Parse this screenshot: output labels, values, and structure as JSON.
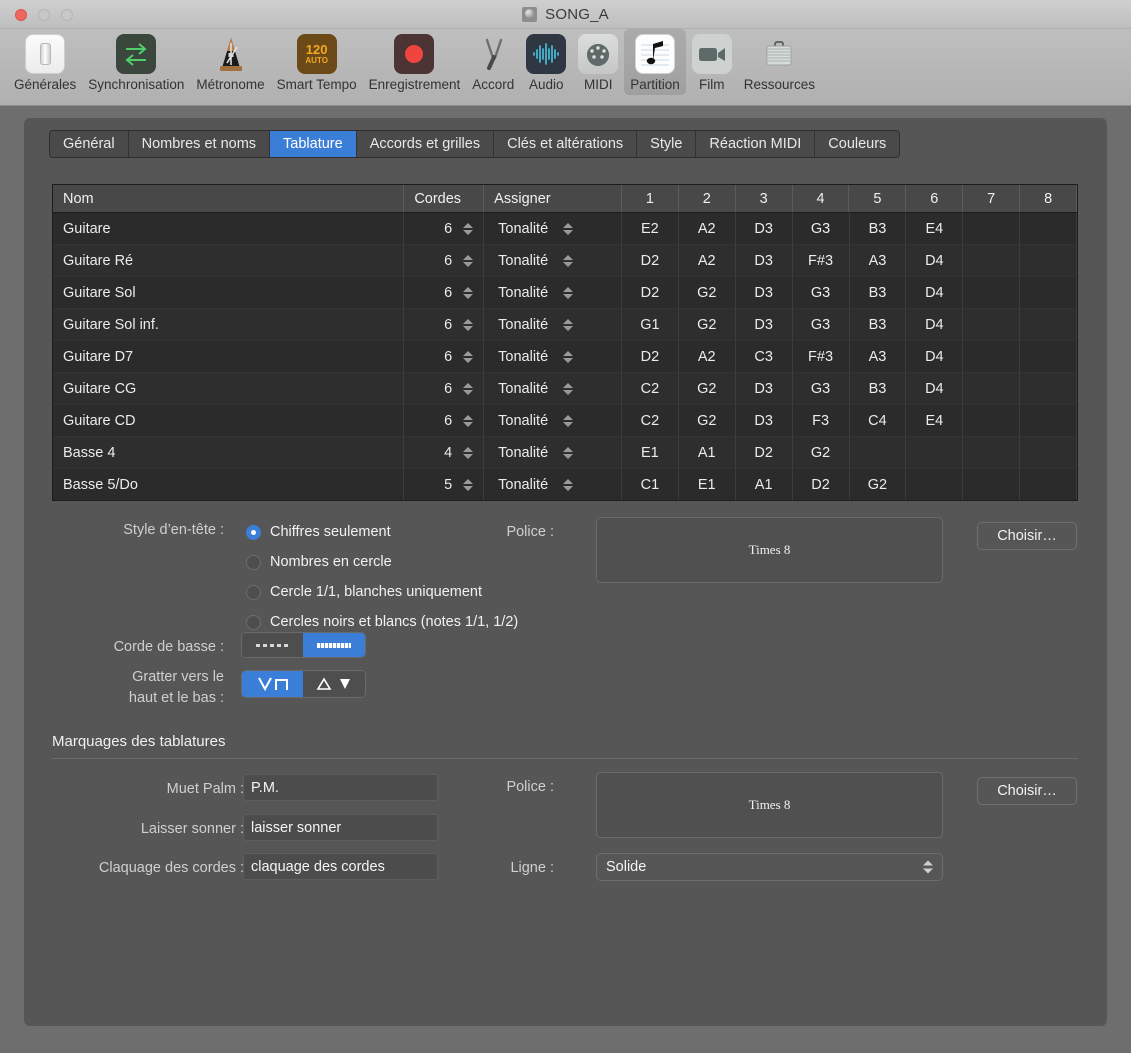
{
  "window": {
    "title": "SONG_A",
    "doc_icon": "disc-icon",
    "traffic_lights": [
      "close-button",
      "minimize-button",
      "zoom-button"
    ]
  },
  "toolbar": {
    "items": [
      {
        "label": "Générales",
        "icon": "switch-icon",
        "selected": false
      },
      {
        "label": "Synchronisation",
        "icon": "sync-arrows-icon",
        "selected": false
      },
      {
        "label": "Métronome",
        "icon": "metronome-icon",
        "selected": false
      },
      {
        "label": "Smart Tempo",
        "icon": "tempo-icon",
        "selected": false,
        "badge_top": "120",
        "badge_bottom": "AUTO"
      },
      {
        "label": "Enregistrement",
        "icon": "record-dot-icon",
        "selected": false
      },
      {
        "label": "Accord",
        "icon": "tuning-fork-icon",
        "selected": false
      },
      {
        "label": "Audio",
        "icon": "waveform-icon",
        "selected": false
      },
      {
        "label": "MIDI",
        "icon": "midi-plug-icon",
        "selected": false
      },
      {
        "label": "Partition",
        "icon": "music-note-icon",
        "selected": true
      },
      {
        "label": "Film",
        "icon": "video-camera-icon",
        "selected": false
      },
      {
        "label": "Ressources",
        "icon": "briefcase-icon",
        "selected": false
      }
    ]
  },
  "tabs": [
    {
      "label": "Général",
      "active": false
    },
    {
      "label": "Nombres et noms",
      "active": false
    },
    {
      "label": "Tablature",
      "active": true
    },
    {
      "label": "Accords et grilles",
      "active": false
    },
    {
      "label": "Clés et altérations",
      "active": false
    },
    {
      "label": "Style",
      "active": false
    },
    {
      "label": "Réaction MIDI",
      "active": false
    },
    {
      "label": "Couleurs",
      "active": false
    }
  ],
  "table": {
    "columns": [
      "Nom",
      "Cordes",
      "Assigner",
      "1",
      "2",
      "3",
      "4",
      "5",
      "6",
      "7",
      "8"
    ],
    "rows": [
      {
        "nom": "Guitare",
        "cordes": "6",
        "assigner": "Tonalité",
        "notes": [
          "E2",
          "A2",
          "D3",
          "G3",
          "B3",
          "E4",
          "",
          ""
        ]
      },
      {
        "nom": "Guitare Ré",
        "cordes": "6",
        "assigner": "Tonalité",
        "notes": [
          "D2",
          "A2",
          "D3",
          "F#3",
          "A3",
          "D4",
          "",
          ""
        ]
      },
      {
        "nom": "Guitare Sol",
        "cordes": "6",
        "assigner": "Tonalité",
        "notes": [
          "D2",
          "G2",
          "D3",
          "G3",
          "B3",
          "D4",
          "",
          ""
        ]
      },
      {
        "nom": "Guitare Sol inf.",
        "cordes": "6",
        "assigner": "Tonalité",
        "notes": [
          "G1",
          "G2",
          "D3",
          "G3",
          "B3",
          "D4",
          "",
          ""
        ]
      },
      {
        "nom": "Guitare D7",
        "cordes": "6",
        "assigner": "Tonalité",
        "notes": [
          "D2",
          "A2",
          "C3",
          "F#3",
          "A3",
          "D4",
          "",
          ""
        ]
      },
      {
        "nom": "Guitare CG",
        "cordes": "6",
        "assigner": "Tonalité",
        "notes": [
          "C2",
          "G2",
          "D3",
          "G3",
          "B3",
          "D4",
          "",
          ""
        ]
      },
      {
        "nom": "Guitare CD",
        "cordes": "6",
        "assigner": "Tonalité",
        "notes": [
          "C2",
          "G2",
          "D3",
          "F3",
          "C4",
          "E4",
          "",
          ""
        ]
      },
      {
        "nom": "Basse 4",
        "cordes": "4",
        "assigner": "Tonalité",
        "notes": [
          "E1",
          "A1",
          "D2",
          "G2",
          "",
          "",
          "",
          ""
        ]
      },
      {
        "nom": "Basse 5/Do",
        "cordes": "5",
        "assigner": "Tonalité",
        "notes": [
          "C1",
          "E1",
          "A1",
          "D2",
          "G2",
          "",
          "",
          ""
        ]
      }
    ]
  },
  "header_style": {
    "label": "Style d’en-tête :",
    "options": [
      {
        "label": "Chiffres seulement",
        "selected": true
      },
      {
        "label": "Nombres en cercle",
        "selected": false
      },
      {
        "label": "Cercle 1/1, blanches uniquement",
        "selected": false
      },
      {
        "label": "Cercles noirs et blancs (notes 1/1, 1/2)",
        "selected": false
      }
    ]
  },
  "font_top": {
    "label": "Police :",
    "value": "Times 8",
    "choose_label": "Choisir…"
  },
  "bass_string": {
    "label": "Corde de basse :",
    "options": [
      {
        "icon": "dashed-line-icon",
        "selected": false
      },
      {
        "icon": "solid-thick-line-icon",
        "selected": true
      }
    ]
  },
  "strum": {
    "label_line1": "Gratter vers le",
    "label_line2": "haut et le bas :",
    "options": [
      {
        "icon": "strum-down-icon",
        "glyph": "V ⌐",
        "selected": true
      },
      {
        "icon": "strum-up-icon",
        "glyph": "△▼",
        "selected": false
      }
    ]
  },
  "markings": {
    "section_title": "Marquages des tablatures",
    "fields": [
      {
        "label": "Muet Palm :",
        "value": "P.M."
      },
      {
        "label": "Laisser sonner :",
        "value": "laisser sonner"
      },
      {
        "label": "Claquage des cordes :",
        "value": "claquage des cordes"
      }
    ],
    "font": {
      "label": "Police :",
      "value": "Times 8",
      "choose_label": "Choisir…"
    },
    "line": {
      "label": "Ligne :",
      "value": "Solide"
    }
  },
  "colors": {
    "accent": "#3a7ed8",
    "panel_bg": "#565656",
    "table_bg": "#2b2b2b",
    "toolbar_bg": "#b5b5b5",
    "record_red": "#f0453f",
    "tempo_orange": "#f4a922"
  }
}
